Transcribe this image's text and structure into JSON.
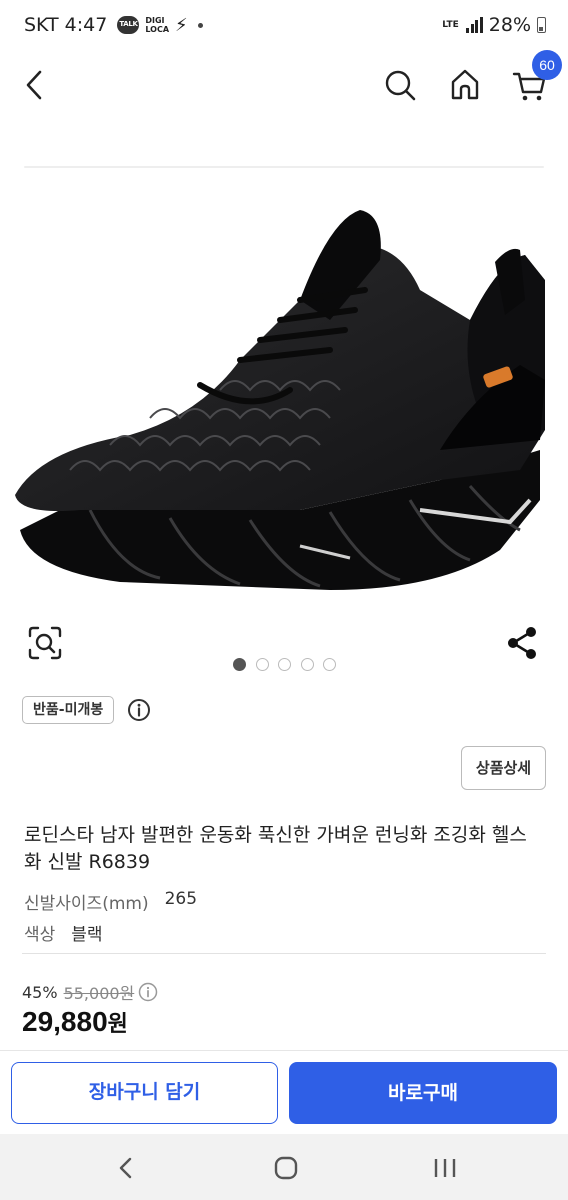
{
  "status_bar": {
    "carrier": "SKT",
    "time": "4:47",
    "digi_label_1": "DIGI",
    "digi_label_2": "LOCA",
    "network": "LTE",
    "battery": "28%"
  },
  "header": {
    "cart_count": "60",
    "accent_color": "#2f5fe6"
  },
  "gallery": {
    "image_count": 5,
    "active_index": 0
  },
  "product": {
    "condition_badge": "반품-미개봉",
    "detail_button": "상품상세",
    "title": "로딘스타 남자 발편한 운동화 푹신한 가벼운 런닝화 조깅화 헬스화 신발 R6839",
    "options": [
      {
        "label": "신발사이즈(mm)",
        "value": "265"
      },
      {
        "label": "색상",
        "value": "블랙"
      }
    ],
    "discount": "45%",
    "original_price": "55,000원",
    "final_price": "29,880",
    "currency": "원"
  },
  "actions": {
    "add_to_cart": "장바구니 담기",
    "buy_now": "바로구매"
  }
}
